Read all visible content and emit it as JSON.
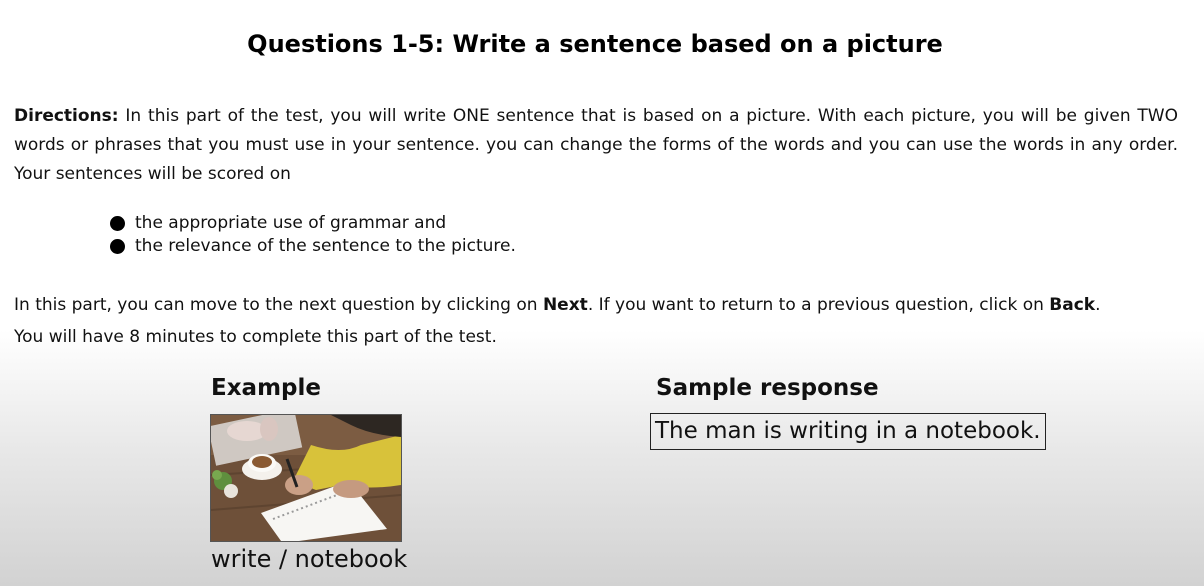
{
  "title": "Questions 1-5: Write a sentence based on a picture",
  "directions": {
    "label": "Directions:",
    "text": "In this part of the test, you will write ONE sentence that is based on a picture. With each picture, you will be given TWO words or phrases that you must use in your sentence. you can change the forms of the words and you can use the words in any order. Your sentences will be scored on"
  },
  "criteria": [
    "the appropriate use of grammar and",
    "the relevance of the sentence to the picture."
  ],
  "navigation": {
    "part1": "In this part, you can move to the next question by clicking on ",
    "next": "Next",
    "part2": ". If you want to return to a previous question, click on ",
    "back": "Back",
    "part3": ".",
    "time_note": "You will have 8 minutes to complete this part of the test."
  },
  "example": {
    "heading": "Example",
    "keywords": "write / notebook"
  },
  "sample": {
    "heading": "Sample response",
    "response": "The man is writing in a notebook."
  }
}
